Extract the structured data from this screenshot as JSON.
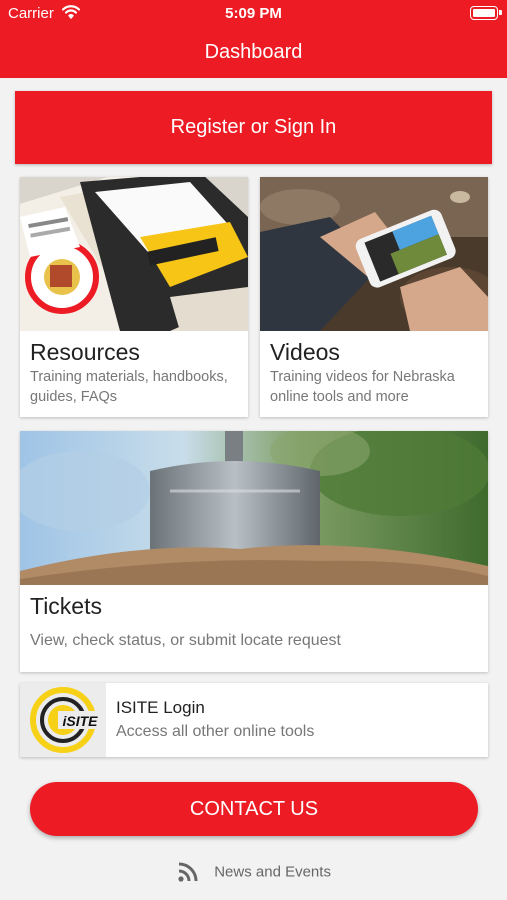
{
  "status_bar": {
    "carrier": "Carrier",
    "time": "5:09 PM",
    "icons": [
      "wifi-icon",
      "battery-icon"
    ]
  },
  "nav": {
    "title": "Dashboard"
  },
  "register_button": {
    "label": "Register or Sign In"
  },
  "cards": {
    "resources": {
      "title": "Resources",
      "description": "Training materials, handbooks, guides, FAQs"
    },
    "videos": {
      "title": "Videos",
      "description": "Training videos for Nebraska online tools and more"
    },
    "tickets": {
      "title": "Tickets",
      "description": "View, check status, or submit locate request"
    },
    "isite": {
      "title": "ISITE Login",
      "description": "Access all other online tools",
      "logo_text": "iSITE"
    }
  },
  "contact_button": {
    "label": "CONTACT US"
  },
  "news": {
    "label": "News and Events",
    "icon": "rss-icon"
  },
  "colors": {
    "brand_red": "#ed1c24",
    "background": "#f2f2f2",
    "card": "#ffffff",
    "muted_text": "#777777"
  }
}
